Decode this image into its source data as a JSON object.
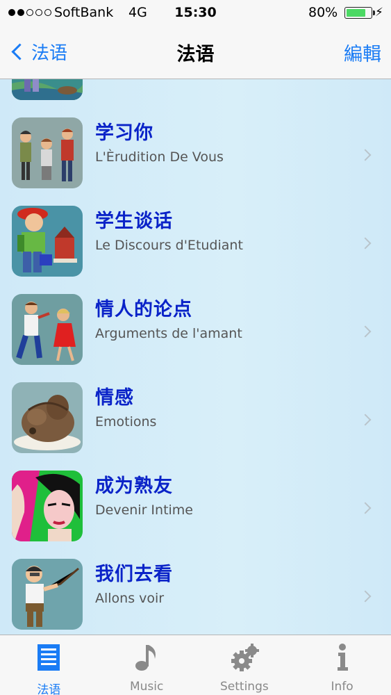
{
  "status_bar": {
    "carrier": "SoftBank",
    "network": "4G",
    "time": "15:30",
    "battery_percent": "80%",
    "battery_level": 0.8,
    "signal_bars_filled": 2,
    "signal_bars_total": 5
  },
  "nav": {
    "back_label": "法语",
    "title": "法语",
    "edit_label": "編輯"
  },
  "lessons": [
    {
      "title": "学习你",
      "subtitle": "L'Èrudition De Vous",
      "icon": "people-chatting-image"
    },
    {
      "title": "学生谈话",
      "subtitle": "Le Discours d'Etudiant",
      "icon": "student-backpack-image"
    },
    {
      "title": "情人的论点",
      "subtitle": "Arguments de l'amant",
      "icon": "arguing-couple-image"
    },
    {
      "title": "情感",
      "subtitle": "Emotions",
      "icon": "bear-image"
    },
    {
      "title": "成为熟友",
      "subtitle": "Devenir Intime",
      "icon": "woman-portrait-image"
    },
    {
      "title": "我们去看",
      "subtitle": "Allons voir",
      "icon": "man-pointing-image"
    }
  ],
  "tabs": [
    {
      "label": "法语",
      "icon": "list-icon",
      "active": true
    },
    {
      "label": "Music",
      "icon": "music-note-icon",
      "active": false
    },
    {
      "label": "Settings",
      "icon": "gears-icon",
      "active": false
    },
    {
      "label": "Info",
      "icon": "info-icon",
      "active": false
    }
  ],
  "colors": {
    "accent": "#1a7cf5",
    "title_blue": "#0a23c8",
    "list_background": "#cfe9f8"
  }
}
